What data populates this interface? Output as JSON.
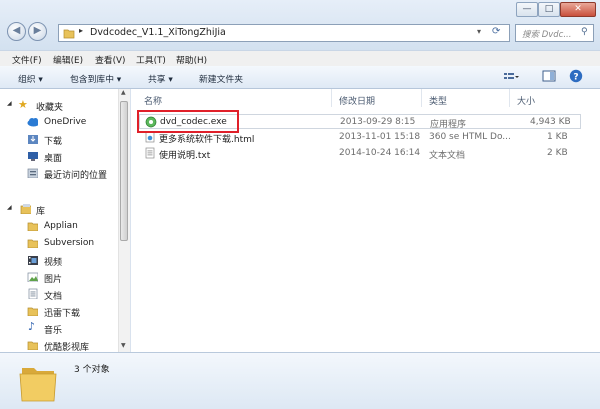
{
  "window": {
    "buttons": {
      "minimize": "—",
      "maximize": "□",
      "close": "✕"
    }
  },
  "address": {
    "path": "Dvdcodec_V1.1_XiTongZhiJia"
  },
  "search": {
    "placeholder": "搜索 Dvdc..."
  },
  "menu": [
    "文件(F)",
    "编辑(E)",
    "查看(V)",
    "工具(T)",
    "帮助(H)"
  ],
  "toolbar": {
    "organize": "组织 ▾",
    "include": "包含到库中 ▾",
    "share": "共享 ▾",
    "new_folder": "新建文件夹"
  },
  "nav": {
    "favorites": "收藏夹",
    "onedrive": "OneDrive",
    "downloads": "下载",
    "desktop": "桌面",
    "recent": "最近访问的位置",
    "libraries": "库",
    "applian": "Applian",
    "subversion": "Subversion",
    "videos": "视频",
    "pictures": "图片",
    "documents": "文档",
    "xunlei": "迅雷下载",
    "music": "音乐",
    "youku": "优酷影视库"
  },
  "columns": {
    "name": "名称",
    "date": "修改日期",
    "type": "类型",
    "size": "大小"
  },
  "files": [
    {
      "name": "dvd_codec.exe",
      "date": "2013-09-29 8:15",
      "type": "应用程序",
      "size": "4,943 KB"
    },
    {
      "name": "更多系统软件下载.html",
      "date": "2013-11-01 15:18",
      "type": "360 se HTML Do...",
      "size": "1 KB"
    },
    {
      "name": "使用说明.txt",
      "date": "2014-10-24 16:14",
      "type": "文本文档",
      "size": "2 KB"
    }
  ],
  "status": {
    "count": "3 个对象"
  }
}
